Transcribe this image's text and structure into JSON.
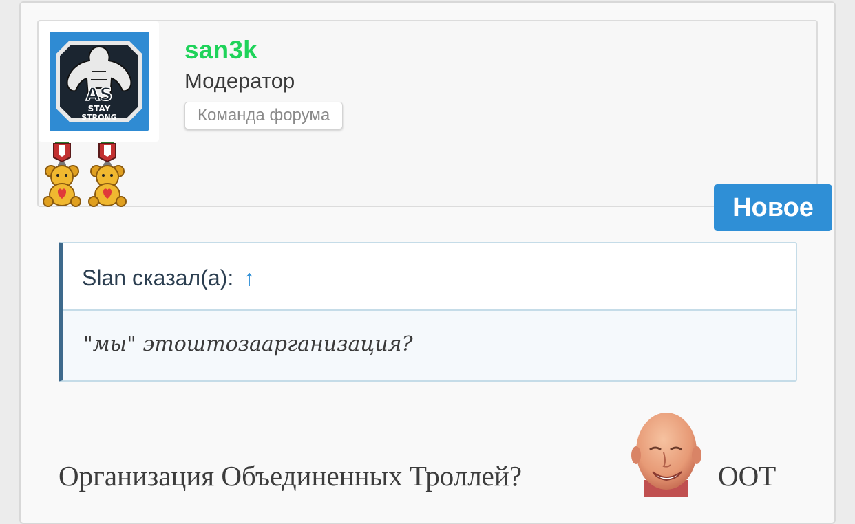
{
  "post": {
    "author": {
      "username": "san3k",
      "user_title": "Модератор",
      "banner": "Команда форума",
      "avatar": {
        "logo_text_main": "AS",
        "logo_text_sub1": "STAY",
        "logo_text_sub2": "STRONG",
        "background_color": "#2f8bd3"
      },
      "awards": [
        "teddy-bear-medal-icon",
        "teddy-bear-medal-icon"
      ]
    },
    "badge_new": "Новое",
    "quote": {
      "attribution": "Slan сказал(а):",
      "jump_arrow": "↑",
      "text": "\"мы\" этоштозаарганизация?"
    },
    "message": {
      "text": "Организация Объединенных Троллей?",
      "smiley": "bald-man-smiley",
      "tail": "ООТ"
    }
  },
  "colors": {
    "username": "#1fd35a",
    "badge_bg": "#2f8fd6",
    "quote_border": "#3e6a8c",
    "link": "#2f8fd6"
  }
}
